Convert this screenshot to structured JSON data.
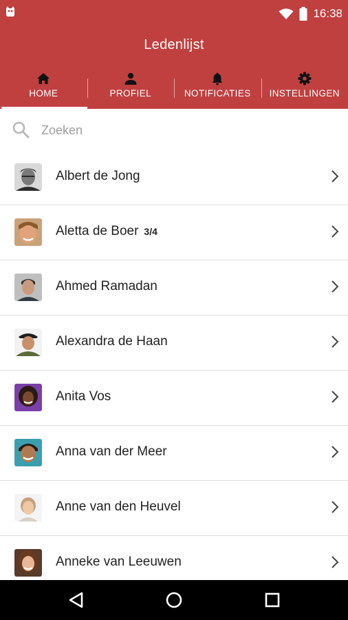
{
  "status_bar": {
    "time": "16:38",
    "icons": [
      "app-notification-icon",
      "wifi-icon",
      "battery-icon"
    ]
  },
  "app_bar": {
    "title": "Ledenlijst",
    "background": "#c04040",
    "tabs": [
      {
        "label": "HOME",
        "icon": "home-icon",
        "active": true
      },
      {
        "label": "PROFIEL",
        "icon": "person-icon",
        "active": false
      },
      {
        "label": "NOTIFICATIES",
        "icon": "bell-icon",
        "active": false
      },
      {
        "label": "INSTELLINGEN",
        "icon": "gear-icon",
        "active": false
      }
    ]
  },
  "search": {
    "placeholder": "Zoeken",
    "value": ""
  },
  "members": [
    {
      "name": "Albert de Jong",
      "badge": ""
    },
    {
      "name": "Aletta de Boer",
      "badge": "3/4"
    },
    {
      "name": "Ahmed Ramadan",
      "badge": ""
    },
    {
      "name": "Alexandra de Haan",
      "badge": ""
    },
    {
      "name": "Anita Vos",
      "badge": ""
    },
    {
      "name": "Anna van der Meer",
      "badge": ""
    },
    {
      "name": "Anne van den Heuvel",
      "badge": ""
    },
    {
      "name": "Anneke van Leeuwen",
      "badge": ""
    }
  ],
  "nav_bar": [
    "back-icon",
    "home-circle-icon",
    "recents-icon"
  ]
}
